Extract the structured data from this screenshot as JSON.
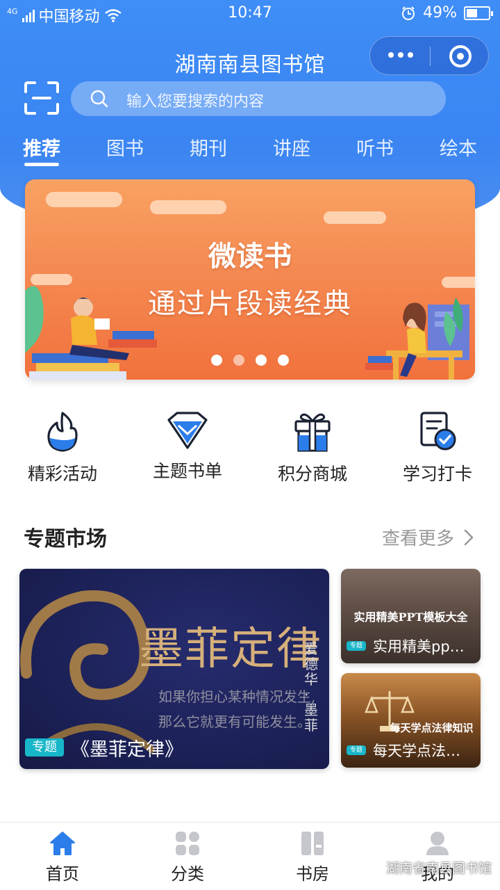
{
  "status_bar": {
    "network": "4G",
    "carrier": "中国移动",
    "time": "10:47",
    "battery_text": "49%",
    "battery_level": 0.49,
    "icons": [
      "signal-icon",
      "wifi-icon",
      "alarm-icon",
      "battery-icon"
    ]
  },
  "header": {
    "title": "湖南南县图书馆",
    "capsule_icons": [
      "more-dots-icon",
      "close-target-icon"
    ],
    "scan_icon": "scan-icon"
  },
  "search": {
    "placeholder": "输入您要搜索的内容",
    "icon": "search-icon"
  },
  "tabs": [
    {
      "label": "推荐",
      "active": true
    },
    {
      "label": "图书",
      "active": false
    },
    {
      "label": "期刊",
      "active": false
    },
    {
      "label": "讲座",
      "active": false
    },
    {
      "label": "听书",
      "active": false
    },
    {
      "label": "绘本",
      "active": false
    }
  ],
  "banner": {
    "title": "微读书",
    "subtitle": "通过片段读经典",
    "slide_count": 4,
    "active_slide": 2
  },
  "quick_menu": [
    {
      "label": "精彩活动",
      "icon": "flame-icon"
    },
    {
      "label": "主题书单",
      "icon": "diamond-icon"
    },
    {
      "label": "积分商城",
      "icon": "gift-icon"
    },
    {
      "label": "学习打卡",
      "icon": "checklist-icon"
    }
  ],
  "topic_market": {
    "title": "专题市场",
    "more_label": "查看更多",
    "featured": {
      "tag": "专题",
      "caption": "《墨菲定律》",
      "art_title": "墨菲定律",
      "art_line1": "如果你担心某种情况发生,",
      "art_line2": "那么它就更有可能发生。",
      "art_author": "爱德华 · 墨菲"
    },
    "items": [
      {
        "tag": "专题",
        "caption": "实用精美pp…",
        "art_text": "实用精美PPT模板大全"
      },
      {
        "tag": "专题",
        "caption": "每天学点法…",
        "art_text": "每天学点法律知识"
      }
    ]
  },
  "bottom_nav": [
    {
      "label": "首页",
      "icon": "home-icon",
      "active": true
    },
    {
      "label": "分类",
      "icon": "grid-icon",
      "active": false
    },
    {
      "label": "书房",
      "icon": "bookshelf-icon",
      "active": false
    },
    {
      "label": "我的",
      "icon": "user-icon",
      "active": false
    }
  ],
  "watermark": "湖南省南县图书馆",
  "colors": {
    "primary": "#3f8df6",
    "banner": "#f48a52",
    "tag": "#18b6c9",
    "nav_active": "#2b7de9"
  }
}
